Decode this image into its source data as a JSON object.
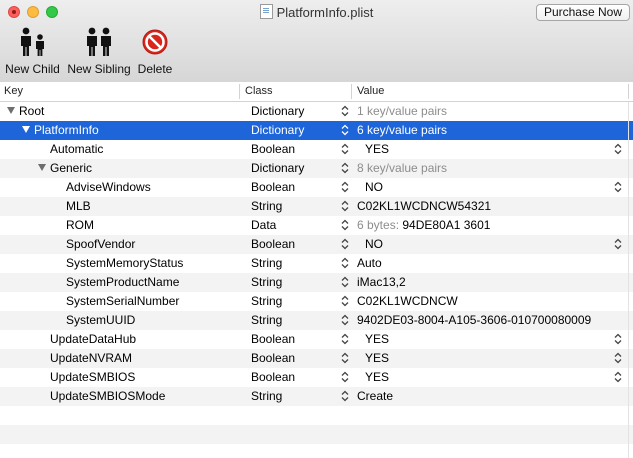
{
  "window": {
    "title": "PlatformInfo.plist"
  },
  "toolbar": {
    "purchase_label": "Purchase Now",
    "new_child_label": "New Child",
    "new_sibling_label": "New Sibling",
    "delete_label": "Delete"
  },
  "columns": {
    "key": "Key",
    "class": "Class",
    "value": "Value"
  },
  "rows": [
    {
      "key": "Root",
      "class": "Dictionary",
      "value": "1 key/value pairs",
      "value_style": "dim",
      "disclosure": "open"
    },
    {
      "key": "PlatformInfo",
      "class": "Dictionary",
      "value": "6 key/value pairs",
      "value_style": "dim",
      "disclosure": "open",
      "selected": true
    },
    {
      "key": "Automatic",
      "class": "Boolean",
      "value": "YES",
      "popup": true
    },
    {
      "key": "Generic",
      "class": "Dictionary",
      "value": "8 key/value pairs",
      "value_style": "dim",
      "disclosure": "open"
    },
    {
      "key": "AdviseWindows",
      "class": "Boolean",
      "value": "NO",
      "popup": true
    },
    {
      "key": "MLB",
      "class": "String",
      "value": "C02KL1WCDNCW54321"
    },
    {
      "key": "ROM",
      "class": "Data",
      "value_prefix": "6 bytes:",
      "value": "94DE80A1 3601"
    },
    {
      "key": "SpoofVendor",
      "class": "Boolean",
      "value": "NO",
      "popup": true
    },
    {
      "key": "SystemMemoryStatus",
      "class": "String",
      "value": "Auto"
    },
    {
      "key": "SystemProductName",
      "class": "String",
      "value": "iMac13,2"
    },
    {
      "key": "SystemSerialNumber",
      "class": "String",
      "value": "C02KL1WCDNCW"
    },
    {
      "key": "SystemUUID",
      "class": "String",
      "value": "9402DE03-8004-A105-3606-010700080009"
    },
    {
      "key": "UpdateDataHub",
      "class": "Boolean",
      "value": "YES",
      "popup": true
    },
    {
      "key": "UpdateNVRAM",
      "class": "Boolean",
      "value": "YES",
      "popup": true
    },
    {
      "key": "UpdateSMBIOS",
      "class": "Boolean",
      "value": "YES",
      "popup": true
    },
    {
      "key": "UpdateSMBIOSMode",
      "class": "String",
      "value": "Create"
    }
  ],
  "colors": {
    "selection": "#1d65d8",
    "stripe": "#f3f3f3",
    "delete_red": "#d9261c"
  }
}
